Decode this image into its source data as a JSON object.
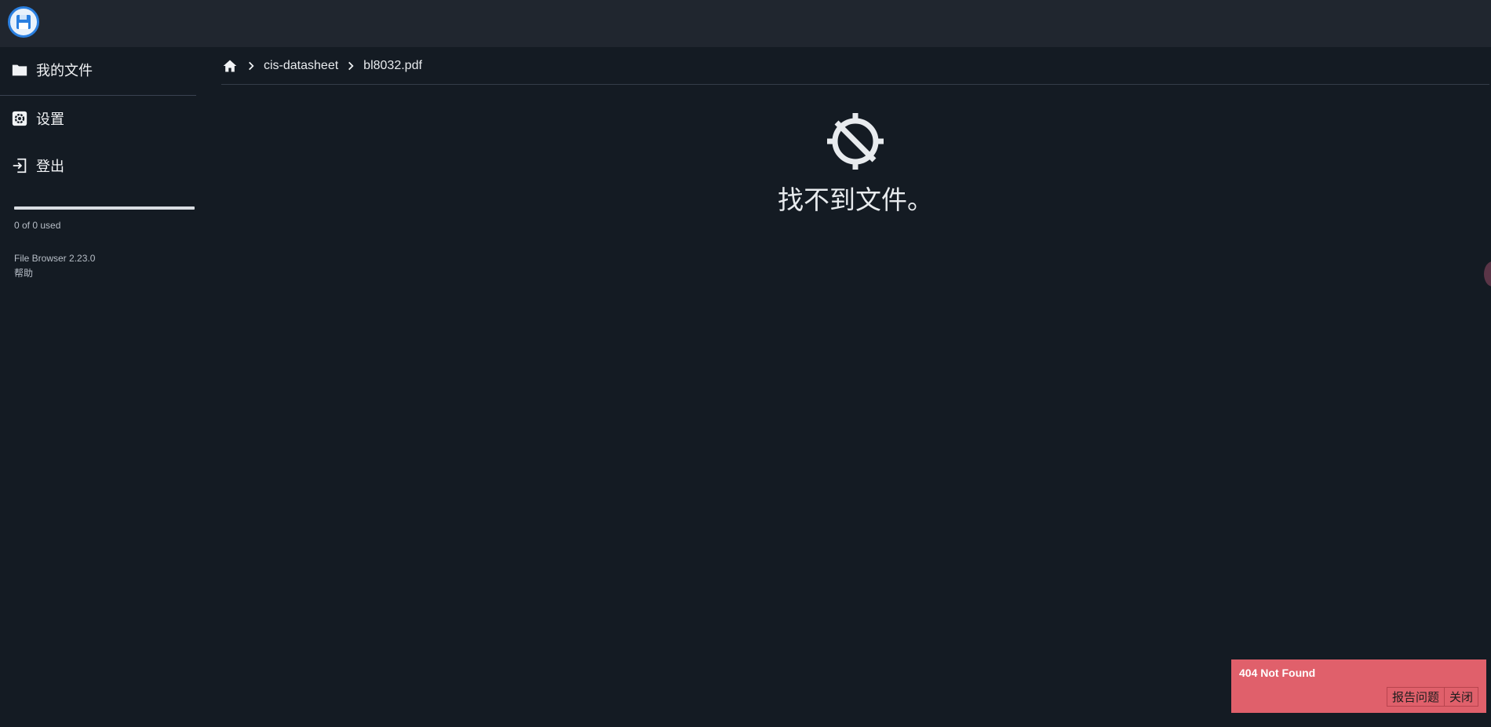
{
  "sidebar": {
    "items": [
      {
        "label": "我的文件",
        "icon": "folder-icon"
      },
      {
        "label": "设置",
        "icon": "gear-icon"
      },
      {
        "label": "登出",
        "icon": "logout-icon"
      }
    ],
    "usage_text": "0 of 0 used",
    "usage_fraction": 0,
    "version": "File Browser 2.23.0",
    "help": "帮助"
  },
  "breadcrumb": {
    "home_icon": "home-icon",
    "items": [
      "cis-datasheet",
      "bl8032.pdf"
    ]
  },
  "empty_state": {
    "icon": "gps-off-icon",
    "message": "找不到文件。"
  },
  "toast": {
    "title": "404 Not Found",
    "report_label": "报告问题",
    "close_label": "关闭",
    "background": "#e0606b"
  },
  "colors": {
    "background": "#141b23",
    "topbar": "#20262f",
    "accent": "#2a7fe0"
  }
}
